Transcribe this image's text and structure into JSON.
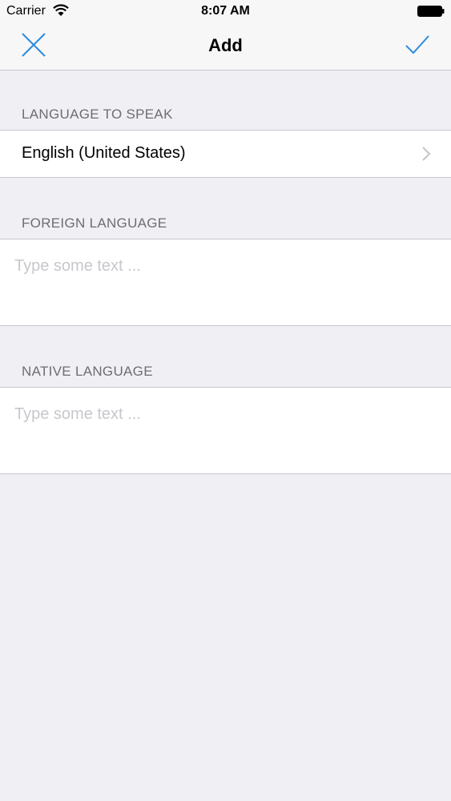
{
  "status_bar": {
    "carrier": "Carrier",
    "time": "8:07 AM",
    "icons": [
      "wifi-icon",
      "battery-icon"
    ]
  },
  "nav": {
    "title": "Add",
    "left_icon": "close-icon",
    "right_icon": "checkmark-icon",
    "accent_color": "#2b8be0"
  },
  "sections": {
    "language_to_speak": {
      "header": "LANGUAGE TO SPEAK",
      "value": "English (United States)",
      "accessory_icon": "chevron-right-icon"
    },
    "foreign_language": {
      "header": "FOREIGN LANGUAGE",
      "placeholder": "Type some text ..."
    },
    "native_language": {
      "header": "NATIVE LANGUAGE",
      "placeholder": "Type some text ..."
    }
  },
  "colors": {
    "background": "#efeff4",
    "cell": "#ffffff",
    "header_text": "#6d6d72",
    "placeholder": "#c7c7cd",
    "separator": "#c8c7cc"
  }
}
